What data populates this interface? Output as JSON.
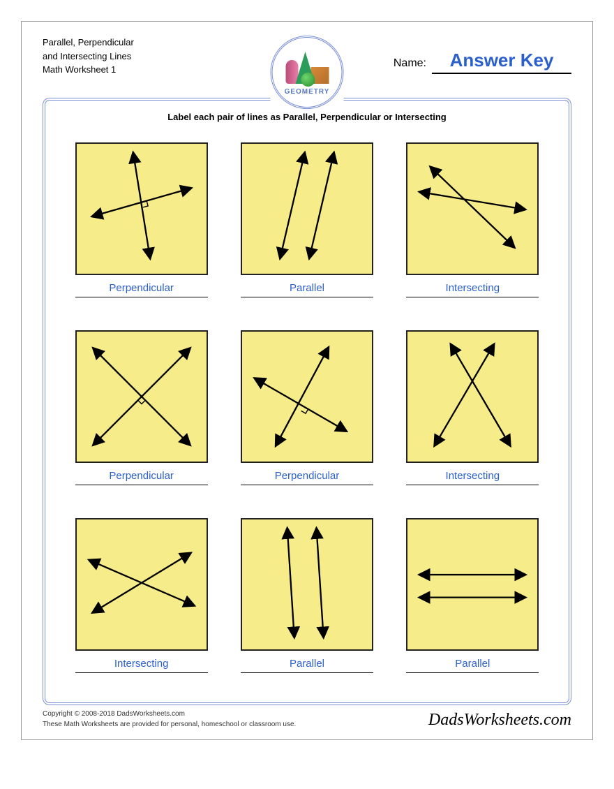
{
  "header": {
    "title_line1": "Parallel, Perpendicular",
    "title_line2": "and Intersecting Lines",
    "title_line3": "Math Worksheet 1",
    "name_label": "Name:",
    "name_value": "Answer Key"
  },
  "logo": {
    "text": "GEOMETRY"
  },
  "instructions": "Label each pair of lines as Parallel, Perpendicular or Intersecting",
  "problems": [
    {
      "type": "perpendicular",
      "answer": "Perpendicular",
      "variant": 1
    },
    {
      "type": "parallel",
      "answer": "Parallel",
      "variant": 1
    },
    {
      "type": "intersecting",
      "answer": "Intersecting",
      "variant": 1
    },
    {
      "type": "perpendicular",
      "answer": "Perpendicular",
      "variant": 2
    },
    {
      "type": "perpendicular",
      "answer": "Perpendicular",
      "variant": 3
    },
    {
      "type": "intersecting",
      "answer": "Intersecting",
      "variant": 2
    },
    {
      "type": "intersecting",
      "answer": "Intersecting",
      "variant": 3
    },
    {
      "type": "parallel",
      "answer": "Parallel",
      "variant": 2
    },
    {
      "type": "parallel",
      "answer": "Parallel",
      "variant": 3
    }
  ],
  "footer": {
    "copyright": "Copyright © 2008-2018 DadsWorksheets.com",
    "usage": "These Math Worksheets are provided for personal, homeschool or classroom use.",
    "brand": "DadsWorksheets.com"
  }
}
